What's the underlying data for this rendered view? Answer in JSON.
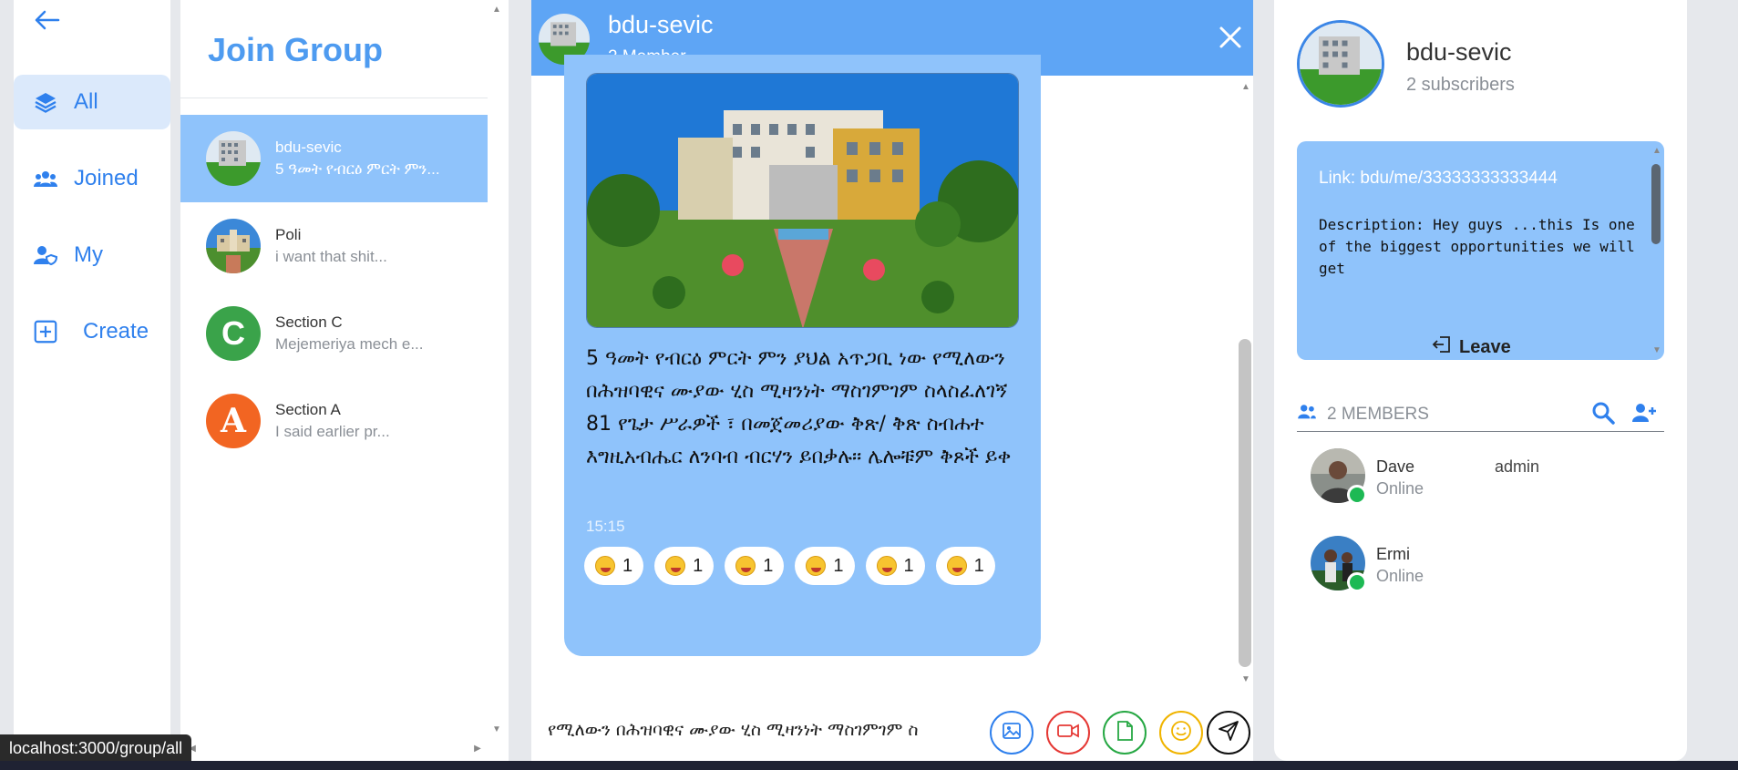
{
  "nav": {
    "items": [
      {
        "label": "All",
        "icon": "layers-icon",
        "active": true
      },
      {
        "label": "Joined",
        "icon": "users-icon",
        "active": false
      },
      {
        "label": "My",
        "icon": "user-shield-icon",
        "active": false
      },
      {
        "label": "Create",
        "icon": "plus-square-icon",
        "active": false
      }
    ]
  },
  "groups": {
    "title": "Join Group",
    "items": [
      {
        "name": "bdu-sevic",
        "preview": "5 ዓመት የብርዕ ምርት ምን...",
        "avatar": "campus-photo",
        "active": true
      },
      {
        "name": "Poli",
        "preview": "i want that shit...",
        "avatar": "campus-photo-2",
        "active": false
      },
      {
        "name": "Section C",
        "preview": "Mejemeriya mech e...",
        "avatar_letter": "C",
        "avatar_color": "#3aa34a",
        "active": false
      },
      {
        "name": "Section A",
        "preview": "I said earlier pr...",
        "avatar_letter": "A",
        "avatar_color": "#f26522",
        "active": false
      }
    ]
  },
  "chat": {
    "title": "bdu-sevic",
    "subtitle": "2 Member",
    "message": {
      "text": "5 ዓመት የብርዕ ምርት ምን ያህል አጥጋቢ ነው የሚለውን በሕዝባዊና ሙያው ሂስ ሚዛንነት ማስገምገም ስላስፈለገኝ 81 የጌታ ሥራዎች ፣ በመጀመሪያው ቅጽ/ ቅጽ ስብሐተ እግዚአብሔር ለንባብ ብርሃን ይበቃሉ። ሌሎቹም ቅጾች ይቀ",
      "time": "15:15",
      "reactions": [
        {
          "emoji": "grinning-face",
          "count": "1"
        },
        {
          "emoji": "astonished-face",
          "count": "1"
        },
        {
          "emoji": "rofl-face",
          "count": "1"
        },
        {
          "emoji": "beaming-face",
          "count": "1"
        },
        {
          "emoji": "eye-roll-face",
          "count": "1"
        },
        {
          "emoji": "grimacing-face",
          "count": "1"
        }
      ]
    },
    "composer_value": "የሚለውን በሕዝባዊና ሙያው ሂስ ሚዛንነት ማስገምገም ስ",
    "controls": [
      {
        "name": "image-attach-button",
        "icon": "image-icon",
        "color": "#2f80ed"
      },
      {
        "name": "video-attach-button",
        "icon": "video-icon",
        "color": "#e53935"
      },
      {
        "name": "file-attach-button",
        "icon": "file-icon",
        "color": "#27a844"
      },
      {
        "name": "emoji-button",
        "icon": "smile-icon",
        "color": "#f0b400"
      },
      {
        "name": "send-button",
        "icon": "send-icon",
        "color": "#111111"
      }
    ]
  },
  "info": {
    "title": "bdu-sevic",
    "subtitle": "2 subscribers",
    "link": "Link: bdu/me/33333333333444",
    "description": "Description: Hey guys ...this Is one of the biggest opportunities we will get",
    "leave_label": "Leave",
    "members_label": "2 MEMBERS",
    "members": [
      {
        "name": "Dave",
        "status": "Online",
        "role": "admin"
      },
      {
        "name": "Ermi",
        "status": "Online",
        "role": ""
      }
    ]
  },
  "status_url": "localhost:3000/group/all",
  "colors": {
    "accent": "#2f80ed",
    "header": "#5ea5f5",
    "bubble": "#8fc3fb",
    "online": "#1db954"
  }
}
